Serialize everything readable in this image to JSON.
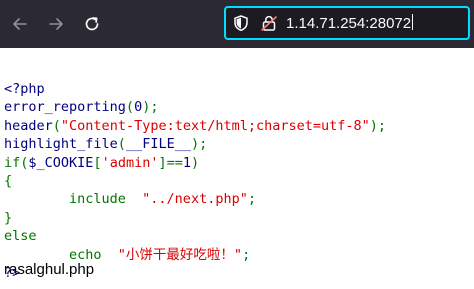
{
  "browser": {
    "url": "1.14.71.254:28072",
    "colors": {
      "toolbar_bg": "#2b2a33",
      "urlbar_bg": "#1c1b22",
      "urlbar_focus_border": "#00ddff",
      "lock_warning": "#ff7a7a"
    },
    "icons": [
      "back-arrow-icon",
      "forward-arrow-icon",
      "reload-icon",
      "shield-icon",
      "lock-icon"
    ]
  },
  "source": {
    "lines": [
      [
        {
          "t": "<?php",
          "c": "d"
        }
      ],
      [
        {
          "t": "error_reporting",
          "c": "d"
        },
        {
          "t": "(",
          "c": "k"
        },
        {
          "t": "0",
          "c": "d"
        },
        {
          "t": ");",
          "c": "k"
        }
      ],
      [
        {
          "t": "header",
          "c": "d"
        },
        {
          "t": "(",
          "c": "k"
        },
        {
          "t": "\"Content-Type:text/html;charset=utf-8\"",
          "c": "s"
        },
        {
          "t": ");",
          "c": "k"
        }
      ],
      [
        {
          "t": "highlight_file",
          "c": "d"
        },
        {
          "t": "(",
          "c": "k"
        },
        {
          "t": "__FILE__",
          "c": "d"
        },
        {
          "t": ");",
          "c": "k"
        }
      ],
      [
        {
          "t": "if(",
          "c": "k"
        },
        {
          "t": "$_COOKIE",
          "c": "d"
        },
        {
          "t": "[",
          "c": "k"
        },
        {
          "t": "'admin'",
          "c": "s"
        },
        {
          "t": "]==",
          "c": "k"
        },
        {
          "t": "1",
          "c": "d"
        },
        {
          "t": ")",
          "c": "k"
        }
      ],
      [
        {
          "t": "{",
          "c": "k"
        }
      ],
      [
        {
          "t": "        include  ",
          "c": "k"
        },
        {
          "t": "\"../next.php\"",
          "c": "s"
        },
        {
          "t": ";",
          "c": "k"
        }
      ],
      [
        {
          "t": "}",
          "c": "k"
        }
      ],
      [
        {
          "t": "else",
          "c": "k"
        }
      ],
      [
        {
          "t": "        echo  ",
          "c": "k"
        },
        {
          "t": "\"小饼干最好吃啦！\"",
          "c": "s"
        },
        {
          "t": ";",
          "c": "k"
        }
      ],
      [
        {
          "t": "?>",
          "c": "d"
        }
      ]
    ],
    "colors": {
      "default": "#000080",
      "keyword": "#007700",
      "string": "#DD0000"
    }
  },
  "trailing_text": "rasalghul.php"
}
